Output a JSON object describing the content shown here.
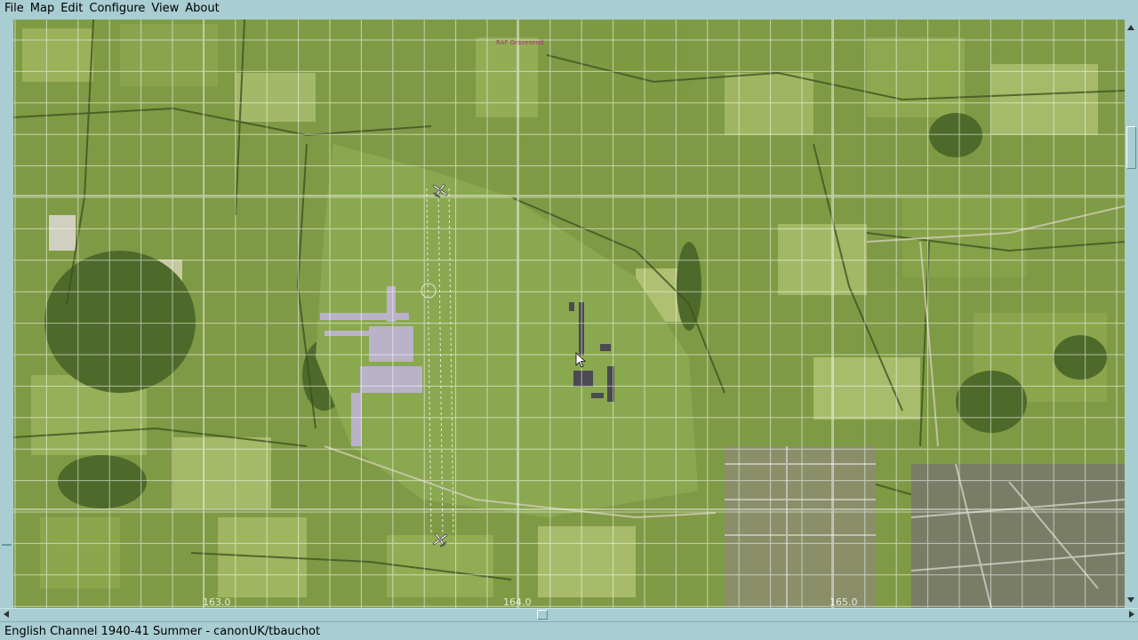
{
  "menu": {
    "items": [
      {
        "label": "File"
      },
      {
        "label": "Map"
      },
      {
        "label": "Edit"
      },
      {
        "label": "Configure"
      },
      {
        "label": "View"
      },
      {
        "label": "About"
      }
    ]
  },
  "map": {
    "airfield_label": "RAF Gravesend",
    "grid_labels": [
      "163.0",
      "164.0",
      "165.0"
    ],
    "icons": [
      "aircraft-icon",
      "aircraft-icon",
      "mouse-pointer-icon"
    ]
  },
  "status": {
    "text": "English Channel 1940-41 Summer - canonUK/tbauchot"
  },
  "colors": {
    "chrome": "#a8cdd2",
    "grid": "#ffffff",
    "field_green": "#7f9a45",
    "airfield_grass": "#8aa84f",
    "airfield_label": "#b0307a"
  }
}
